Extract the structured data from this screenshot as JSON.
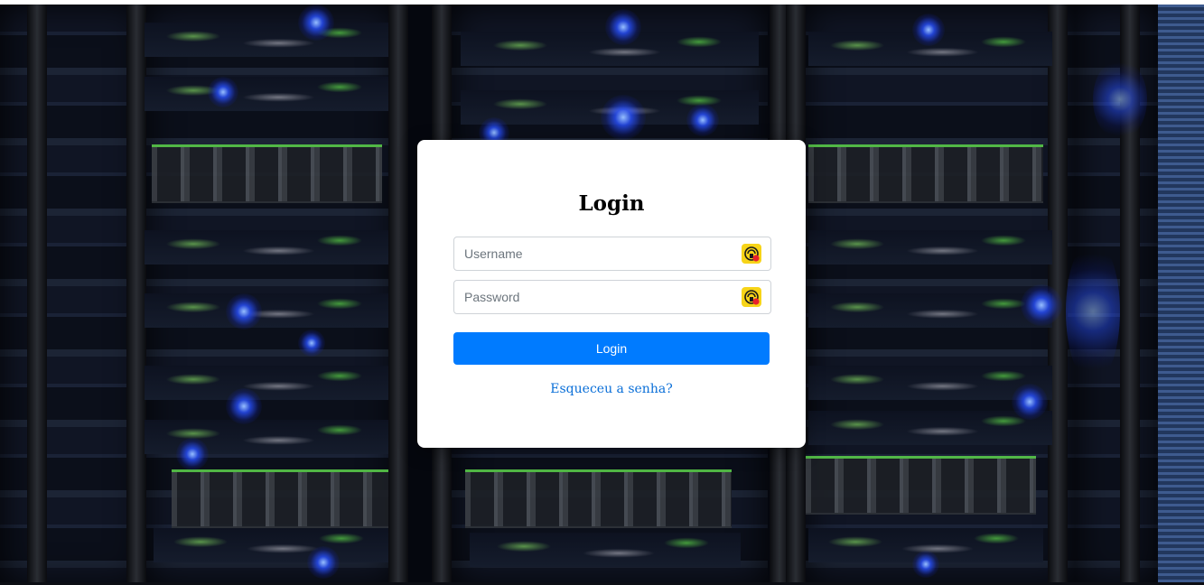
{
  "login_card": {
    "title": "Login",
    "username": {
      "placeholder": "Username",
      "value": "",
      "icon": "password-manager-icon"
    },
    "password": {
      "placeholder": "Password",
      "value": "",
      "icon": "password-manager-icon"
    },
    "submit_label": "Login",
    "forgot_password_label": "Esqueceu a senha?"
  },
  "background": {
    "description_icon": "server-rack-photo"
  },
  "colors": {
    "primary_button": "#007bff",
    "link": "#0a6fd8",
    "card_background": "#ffffff",
    "icon_badge": "#f7d418",
    "icon_alert": "#e8212b"
  }
}
